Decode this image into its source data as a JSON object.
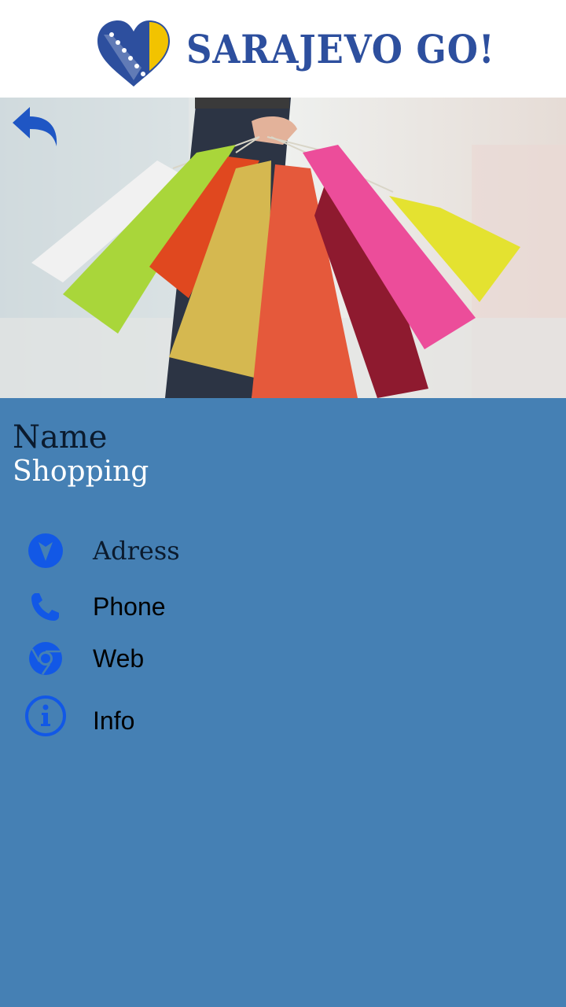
{
  "header": {
    "logo_text": "SARAJEVO GO!"
  },
  "colors": {
    "background": "#4580b4",
    "icon_blue": "#1258e6",
    "logo_blue": "#2d4f9e"
  },
  "icons": {
    "back": "back-arrow-icon",
    "address": "location-arrow-icon",
    "phone": "phone-icon",
    "web": "chrome-icon",
    "info": "info-icon"
  },
  "place": {
    "name_label": "Name",
    "name_value": "Shopping"
  },
  "details": [
    {
      "label": "Adress"
    },
    {
      "label": "Phone"
    },
    {
      "label": "Web"
    },
    {
      "label": "Info"
    }
  ]
}
